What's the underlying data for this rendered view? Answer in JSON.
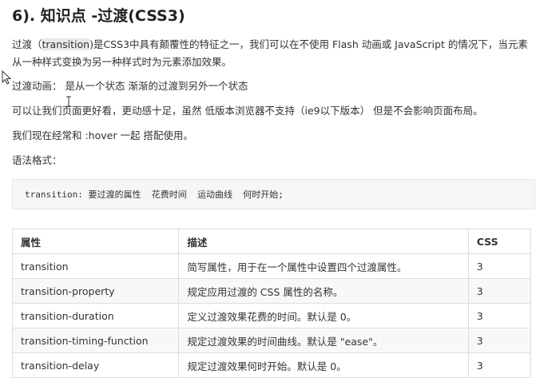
{
  "title": "6). 知识点 -过渡(CSS3)",
  "intro": {
    "before": "过渡（",
    "highlight": "transition",
    "after": ")是CSS3中具有颠覆性的特征之一，我们可以在不使用 Flash 动画或 JavaScript 的情况下，当元素从一种样式变换为另一种样式时为元素添加效果。"
  },
  "para_animation": "过渡动画：   是从一个状态 渐渐的过渡到另外一个状态",
  "para_support": "可以让我们页面更好看，更动感十足，虽然 低版本浏览器不支持（ie9以下版本） 但是不会影响页面布局。",
  "para_usage": "我们现在经常和 :hover 一起 搭配使用。",
  "para_syntax": "语法格式：",
  "code": "transition: 要过渡的属性  花费时间  运动曲线  何时开始;",
  "table": {
    "headers": [
      "属性",
      "描述",
      "CSS"
    ],
    "rows": [
      [
        "transition",
        "简写属性，用于在一个属性中设置四个过渡属性。",
        "3"
      ],
      [
        "transition-property",
        "规定应用过渡的 CSS 属性的名称。",
        "3"
      ],
      [
        "transition-duration",
        "定义过渡效果花费的时间。默认是 0。",
        "3"
      ],
      [
        "transition-timing-function",
        "规定过渡效果的时间曲线。默认是 \"ease\"。",
        "3"
      ],
      [
        "transition-delay",
        "规定过渡效果何时开始。默认是 0。",
        "3"
      ]
    ]
  }
}
